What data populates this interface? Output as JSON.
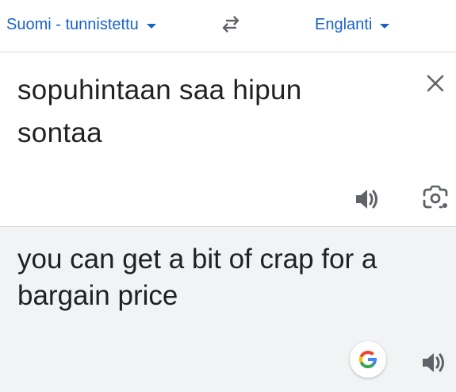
{
  "languages": {
    "source": "Suomi - tunnistettu",
    "target": "Englanti"
  },
  "source_panel": {
    "text": "sopuhintaan saa hipun sontaa"
  },
  "result_panel": {
    "text": "you can get a bit of crap for a bargain price"
  },
  "icons": {
    "swap": "swap-languages-icon",
    "clear": "close-icon",
    "speaker": "speaker-icon",
    "camera": "camera-lens-icon",
    "google": "google-g-icon"
  },
  "colors": {
    "accent": "#1a63c6",
    "result_background": "#f1f3f4",
    "text": "#202124",
    "icon": "#5f6368"
  }
}
